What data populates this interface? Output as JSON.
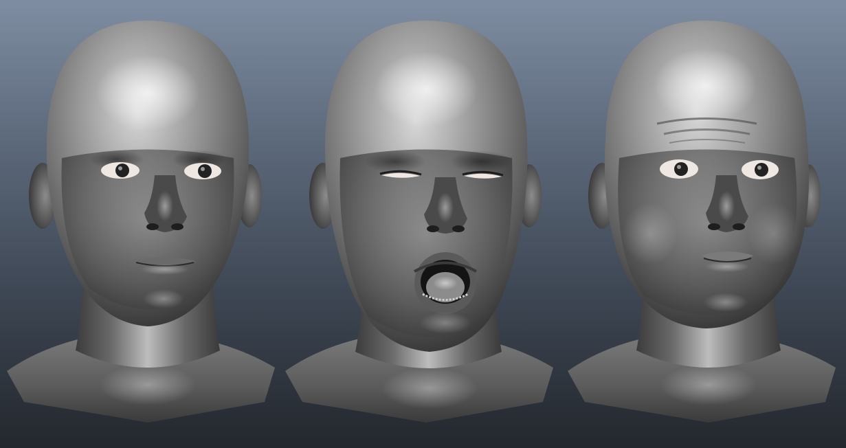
{
  "scene": {
    "background_top": "#7f8da2",
    "background_bottom": "#23272d",
    "material_color": "#9a9a9a",
    "eye_white": "#efe7e2"
  },
  "heads": [
    {
      "id": "neutral",
      "expression": "neutral"
    },
    {
      "id": "yawn",
      "expression": "open-mouth-yawn"
    },
    {
      "id": "puffed",
      "expression": "puffed-cheeks"
    }
  ]
}
